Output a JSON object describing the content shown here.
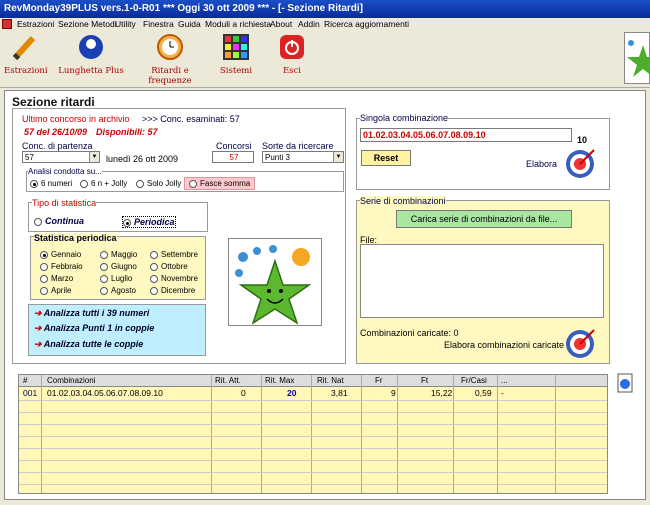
{
  "window": {
    "title": "RevMonday39PLUS vers.1-0-R01  ***  Oggi 30 ott 2009  ***  - [- Sezione Ritardi]"
  },
  "menu": [
    "Estrazioni",
    "Sezione Metodi",
    "Utility",
    "Finestra",
    "Guida",
    "Moduli a richiesta",
    "About",
    "Addin",
    "Ricerca aggiornamenti"
  ],
  "toolbar": {
    "estrazioni": "Estrazioni",
    "lunghetta": "Lunghetta Plus",
    "ritardi": "Ritardi e frequenze",
    "sistemi": "Sistemi",
    "esci": "Esci"
  },
  "section_title": "Sezione ritardi",
  "archive": {
    "label": "Ultimo concorso in archivio",
    "conc_esaminati": ">>> Conc. esaminati: 57",
    "last": "57 del 26/10/09",
    "disponibili": "Disponibili: 57"
  },
  "conc_partenza": {
    "label": "Conc. di partenza",
    "value": "57",
    "date": "lunedì 26 ott 2009"
  },
  "concorsi": {
    "label": "Concorsi",
    "value": "57"
  },
  "sorte": {
    "label": "Sorte da ricercare",
    "value": "Punti 3"
  },
  "analisi": {
    "label": "Analisi condotta su...",
    "options": [
      "6 numeri",
      "6 n + Jolly",
      "Solo Jolly",
      "Fasce somma"
    ]
  },
  "tipo_statistica": {
    "label": "Tipo di statistica",
    "continua": "Continua",
    "periodica": "Periodica"
  },
  "statistica_periodica": {
    "label": "Statistica periodica",
    "months": [
      "Gennaio",
      "Maggio",
      "Settembre",
      "Febbraio",
      "Giugno",
      "Ottobre",
      "Marzo",
      "Luglio",
      "Novembre",
      "Aprile",
      "Agosto",
      "Dicembre"
    ]
  },
  "analizza": {
    "tutti": "Analizza tutti i 39 numeri",
    "punti": "Analizza Punti 1 in coppie",
    "coppie": "Analizza tutte le coppie"
  },
  "singola": {
    "label": "Singola combinazione",
    "value": "01.02.03.04.05.06.07.08.09.10",
    "count": "10",
    "reset": "Reset",
    "elabora": "Elabora"
  },
  "serie": {
    "label": "Serie di combinazioni",
    "carica": "Carica serie di combinazioni da file...",
    "file_label": "File:",
    "caricate": "Combinazioni caricate: 0",
    "elabora": "Elabora combinazioni caricate"
  },
  "table": {
    "headers": [
      "#",
      "Combinazioni",
      "Rit. Att.",
      "Rit. Max",
      "Rit. Nat",
      "Fr",
      "Ft",
      "Fr/Casi",
      "..."
    ],
    "row": [
      "001",
      "01.02.03.04.05.06.07.08.09.10",
      "0",
      "20",
      "3,81",
      "9",
      "15,22",
      "0,59",
      "-"
    ]
  },
  "colors": {
    "title_bar": "#0a2a9a",
    "yellow_panel": "#fff8c0",
    "cyan_panel": "#bfefff",
    "accent_red": "#c00000"
  }
}
